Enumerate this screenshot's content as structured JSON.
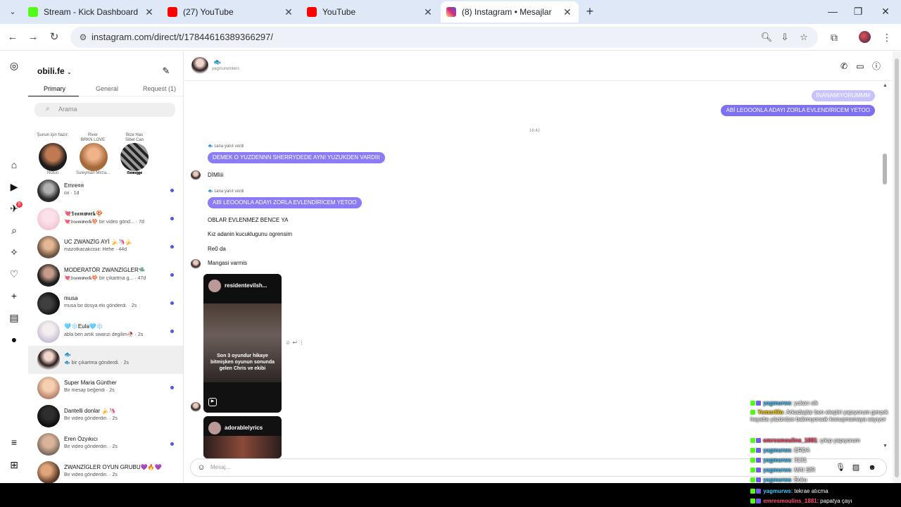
{
  "browser": {
    "tabs": [
      {
        "title": "Stream - Kick Dashboard",
        "color": "#53fc18"
      },
      {
        "title": "(27) YouTube",
        "color": "#ff0000"
      },
      {
        "title": "YouTube",
        "color": "#ff0000"
      },
      {
        "title": "(8) Instagram • Mesajlar",
        "color": "#d6249f"
      }
    ],
    "url": "instagram.com/direct/t/17844616389366297/"
  },
  "sidebar": {
    "account": "obili.fe",
    "inbox_tabs": [
      "Primary",
      "General",
      "Request (1)"
    ],
    "search_placeholder": "Arama",
    "badge_count": "6",
    "notes": [
      {
        "note": "Şunun için hazır:",
        "name": "Notun"
      },
      {
        "note": "River\nBRKN LOVE",
        "name": "Suleyman Mirza..."
      },
      {
        "note": "Bize Has\nSibel Can",
        "name": "𝕾𝖚𝖒𝖊𝖌𝖌𝖊"
      }
    ],
    "chats": [
      {
        "name": "Emre¤я",
        "preview": "ox · 1d",
        "unread": true
      },
      {
        "name": "💘𝕿𝖊𝖆𝖒𝖜𝖔𝖗𝖐🍄",
        "preview": "💘𝕿𝖊𝖆𝖒𝖜𝖔𝖗𝖐🍄 bir video gönd... · 7d",
        "unread": true
      },
      {
        "name": "UC ZWANZİG AYİ 🍌🦄🍌",
        "preview": "mazotkacakcisiii: Hehe · 44d",
        "unread": true
      },
      {
        "name": "MODERATÖR ZWANZİGLER🛸",
        "preview": "💘𝕿𝖊𝖆𝖒𝖜𝖔𝖗𝖐🍄 bir çıkartma g... · 47d",
        "unread": true
      },
      {
        "name": "musa",
        "preview": "musa bir dosya eki gönderdi. · 2s",
        "unread": true
      },
      {
        "name": "🩵❄️Eula🩵❄️",
        "preview": "abla ben artık swanzi degilim🥀 · 2s",
        "unread": true
      },
      {
        "name": "🐟",
        "preview": "🐟 bir çıkartma gönderdi. · 2s",
        "unread": false
      },
      {
        "name": "Super Maria Günther",
        "preview": "Bir mesajı beğendi · 2s",
        "unread": true
      },
      {
        "name": "Dantelli donlar 🍌🦄",
        "preview": "Bir video gönderdin. · 2s",
        "unread": false
      },
      {
        "name": "Eren Özyıkıcı",
        "preview": "Bir video gönderdin. · 2s",
        "unread": true
      },
      {
        "name": "ZWANZİGLER OYUN GRUBU💜🔥💜",
        "preview": "Bir video gönderdin. · 2s",
        "unread": false
      }
    ]
  },
  "conversation": {
    "header_name": "🐟",
    "header_username": "yagmurwinters",
    "messages_sent": [
      "İNANAMIYORUMMM",
      "ABİ LEOOONLA ADAYI ZORLA EVLENDİRİCEM YETOO"
    ],
    "timestamp": "16:42",
    "reply_note": "sana yanıt verdi",
    "quoted_1": "DEMEK O YUZDENNN SHERRYDEDE AYNI YUZUKDEN VARDIII",
    "recv_1": "DİMİiii",
    "quoted_2": "ABİ LEOOONLA ADAYI ZORLA EVLENDİRİCEM YETOO",
    "recv_2": "OBLAR EVLENMEZ BENCE YA",
    "recv_3": "Kız adanin kucuklugunu ogrensim",
    "recv_4": "Re0 da",
    "recv_5": "Mangasi varmis",
    "post1_user": "residentevilsh...",
    "post1_caption": "Son 3 oyundur hikaye bitmişken oyunun sonunda gelen Chris ve ekibi",
    "post2_user": "adorablelyrics",
    "composer_placeholder": "Mesaj..."
  },
  "overlay_chat": [
    {
      "user": "yagmurws",
      "msg": ": yukarı sik",
      "color": "#44c8ff"
    },
    {
      "user": "Yemorlifo",
      "msg": ": Arkadaşlar ben eleştiri yapıyorum gerçek hayatta yüzünüze bakmıyorsak konuşmamaya sayıyor",
      "color": "#ffd700"
    },
    {
      "user": "emresmoulins_1881",
      "msg": ": çıkıp yapıyorum",
      "color": "#ff4d6d"
    },
    {
      "user": "yagmurws",
      "msg": ": ERDA",
      "color": "#44c8ff"
    },
    {
      "user": "yagmurws",
      "msg": ": 3131",
      "color": "#44c8ff"
    },
    {
      "user": "yagmurws",
      "msg": ": MAI SİR",
      "color": "#44c8ff"
    },
    {
      "user": "yagmurws",
      "msg": ": Boku",
      "color": "#44c8ff"
    },
    {
      "user": "yagmurws",
      "msg": ": tekrae atıcma",
      "color": "#44c8ff"
    },
    {
      "user": "emresmoulins_1881",
      "msg": ": papatya çayı",
      "color": "#ff4d6d"
    }
  ]
}
